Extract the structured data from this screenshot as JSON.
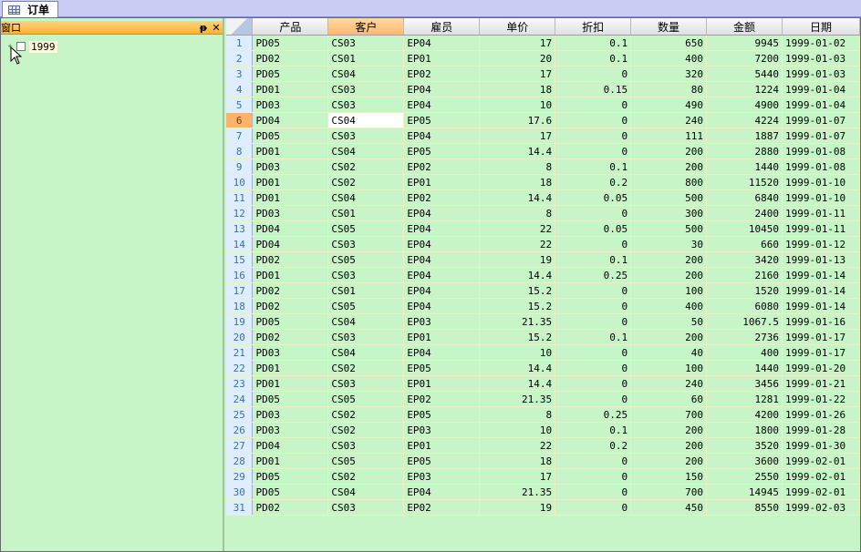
{
  "tab": {
    "label": "订单"
  },
  "panel": {
    "title": "窗口",
    "pin": "ᵽ",
    "close": "✕"
  },
  "tree": {
    "items": [
      {
        "expander": "+",
        "label": "1999"
      }
    ]
  },
  "grid": {
    "columns": [
      "产品",
      "客户",
      "雇员",
      "单价",
      "折扣",
      "数量",
      "金额",
      "日期"
    ],
    "active_column": 1,
    "current_row": 6,
    "rows": [
      [
        "PD05",
        "CS03",
        "EP04",
        "17",
        "0.1",
        "650",
        "9945",
        "1999-01-02"
      ],
      [
        "PD02",
        "CS01",
        "EP01",
        "20",
        "0.1",
        "400",
        "7200",
        "1999-01-03"
      ],
      [
        "PD05",
        "CS04",
        "EP02",
        "17",
        "0",
        "320",
        "5440",
        "1999-01-03"
      ],
      [
        "PD01",
        "CS03",
        "EP04",
        "18",
        "0.15",
        "80",
        "1224",
        "1999-01-04"
      ],
      [
        "PD03",
        "CS03",
        "EP04",
        "10",
        "0",
        "490",
        "4900",
        "1999-01-04"
      ],
      [
        "PD04",
        "CS04",
        "EP05",
        "17.6",
        "0",
        "240",
        "4224",
        "1999-01-07"
      ],
      [
        "PD05",
        "CS03",
        "EP04",
        "17",
        "0",
        "111",
        "1887",
        "1999-01-07"
      ],
      [
        "PD01",
        "CS04",
        "EP05",
        "14.4",
        "0",
        "200",
        "2880",
        "1999-01-08"
      ],
      [
        "PD03",
        "CS02",
        "EP02",
        "8",
        "0.1",
        "200",
        "1440",
        "1999-01-08"
      ],
      [
        "PD01",
        "CS02",
        "EP01",
        "18",
        "0.2",
        "800",
        "11520",
        "1999-01-10"
      ],
      [
        "PD01",
        "CS04",
        "EP02",
        "14.4",
        "0.05",
        "500",
        "6840",
        "1999-01-10"
      ],
      [
        "PD03",
        "CS01",
        "EP04",
        "8",
        "0",
        "300",
        "2400",
        "1999-01-11"
      ],
      [
        "PD04",
        "CS05",
        "EP04",
        "22",
        "0.05",
        "500",
        "10450",
        "1999-01-11"
      ],
      [
        "PD04",
        "CS03",
        "EP04",
        "22",
        "0",
        "30",
        "660",
        "1999-01-12"
      ],
      [
        "PD02",
        "CS05",
        "EP04",
        "19",
        "0.1",
        "200",
        "3420",
        "1999-01-13"
      ],
      [
        "PD01",
        "CS03",
        "EP04",
        "14.4",
        "0.25",
        "200",
        "2160",
        "1999-01-14"
      ],
      [
        "PD02",
        "CS01",
        "EP04",
        "15.2",
        "0",
        "100",
        "1520",
        "1999-01-14"
      ],
      [
        "PD02",
        "CS05",
        "EP04",
        "15.2",
        "0",
        "400",
        "6080",
        "1999-01-14"
      ],
      [
        "PD05",
        "CS04",
        "EP03",
        "21.35",
        "0",
        "50",
        "1067.5",
        "1999-01-16"
      ],
      [
        "PD02",
        "CS03",
        "EP01",
        "15.2",
        "0.1",
        "200",
        "2736",
        "1999-01-17"
      ],
      [
        "PD03",
        "CS04",
        "EP04",
        "10",
        "0",
        "40",
        "400",
        "1999-01-17"
      ],
      [
        "PD01",
        "CS02",
        "EP05",
        "14.4",
        "0",
        "100",
        "1440",
        "1999-01-20"
      ],
      [
        "PD01",
        "CS03",
        "EP01",
        "14.4",
        "0",
        "240",
        "3456",
        "1999-01-21"
      ],
      [
        "PD05",
        "CS05",
        "EP02",
        "21.35",
        "0",
        "60",
        "1281",
        "1999-01-22"
      ],
      [
        "PD03",
        "CS02",
        "EP05",
        "8",
        "0.25",
        "700",
        "4200",
        "1999-01-26"
      ],
      [
        "PD03",
        "CS02",
        "EP03",
        "10",
        "0.1",
        "200",
        "1800",
        "1999-01-28"
      ],
      [
        "PD04",
        "CS03",
        "EP01",
        "22",
        "0.2",
        "200",
        "3520",
        "1999-01-30"
      ],
      [
        "PD01",
        "CS05",
        "EP05",
        "18",
        "0",
        "200",
        "3600",
        "1999-02-01"
      ],
      [
        "PD05",
        "CS02",
        "EP03",
        "17",
        "0",
        "150",
        "2550",
        "1999-02-01"
      ],
      [
        "PD05",
        "CS04",
        "EP04",
        "21.35",
        "0",
        "700",
        "14945",
        "1999-02-01"
      ],
      [
        "PD02",
        "CS03",
        "EP02",
        "19",
        "0",
        "450",
        "8550",
        "1999-02-03"
      ]
    ]
  }
}
